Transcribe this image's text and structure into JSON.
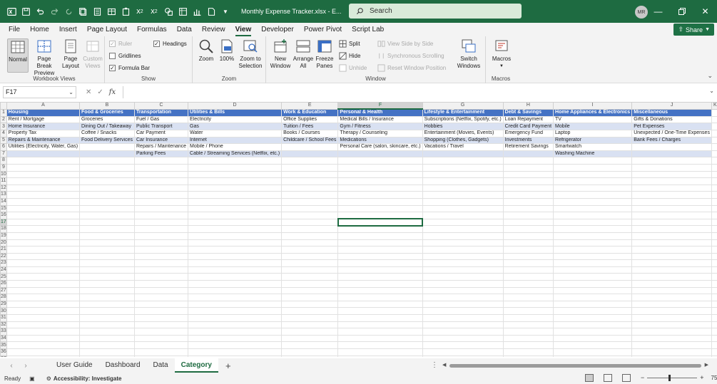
{
  "titlebar": {
    "doc_title": "Monthly Expense Tracker.xlsx  -  E...",
    "search_placeholder": "Search",
    "avatar": "MR"
  },
  "menu": {
    "tabs": [
      "File",
      "Home",
      "Insert",
      "Page Layout",
      "Formulas",
      "Data",
      "Review",
      "View",
      "Developer",
      "Power Pivot",
      "Script Lab"
    ],
    "active_tab": "View",
    "share_label": "Share"
  },
  "ribbon": {
    "workbook_views": {
      "label": "Workbook Views",
      "normal": "Normal",
      "page_break": "Page Break Preview",
      "page_layout": "Page Layout",
      "custom_views": "Custom Views"
    },
    "show": {
      "label": "Show",
      "ruler": "Ruler",
      "gridlines": "Gridlines",
      "formula_bar": "Formula Bar",
      "headings": "Headings"
    },
    "zoom": {
      "label": "Zoom",
      "zoom": "Zoom",
      "hundred": "100%",
      "zoom_selection": "Zoom to Selection"
    },
    "window": {
      "label": "Window",
      "new_window": "New Window",
      "arrange_all": "Arrange All",
      "freeze_panes": "Freeze Panes",
      "split": "Split",
      "hide": "Hide",
      "unhide": "Unhide",
      "view_side": "View Side by Side",
      "sync_scroll": "Synchronous Scrolling",
      "reset_pos": "Reset Window Position",
      "switch_windows": "Switch Windows"
    },
    "macros": {
      "label": "Macros",
      "macros": "Macros"
    }
  },
  "formula_bar": {
    "name_box": "F17",
    "formula": ""
  },
  "grid": {
    "columns": [
      "A",
      "B",
      "C",
      "D",
      "E",
      "F",
      "G",
      "H",
      "I",
      "J",
      "K"
    ],
    "selected_column": "F",
    "selected_row": 17,
    "active_cell": "F17",
    "header_row": [
      "Housing",
      "Food & Groceries",
      "Transportation",
      "Utilities & Bills",
      "Work & Education",
      "Personal & Health",
      "Lifestyle & Entertainment",
      "Debt & Savings",
      "Home Appliances & Electronics",
      "Miscellaneous"
    ],
    "rows": [
      [
        "Rent / Mortgage",
        "Groceries",
        "Fuel / Gas",
        "Electricity",
        "Office Supplies",
        "Medical Bills / Insurance",
        "Subscriptions (Netflix, Spotify, etc.)",
        "Loan Repayment",
        "TV",
        "Gifts & Donations"
      ],
      [
        "Home Insurance",
        "Dining Out / Takeaway",
        "Public Transport",
        "Gas",
        "Tuition / Fees",
        "Gym / Fitness",
        "Hobbies",
        "Credit Card Payment",
        "Mobile",
        "Pet Expenses"
      ],
      [
        "Property Tax",
        "Coffee / Snacks",
        "Car Payment",
        "Water",
        "Books / Courses",
        "Therapy / Counseling",
        "Entertainment (Movies, Events)",
        "Emergency Fund",
        "Laptop",
        "Unexpected / One-Time Expenses"
      ],
      [
        "Repairs & Maintenance",
        "Food Delivery Services",
        "Car Insurance",
        "Internet",
        "Childcare / School Fees",
        "Medications",
        "Shopping (Clothes, Gadgets)",
        "Investments",
        "Refrigerator",
        "Bank Fees / Charges"
      ],
      [
        "Utilities (Electricity, Water, Gas)",
        "",
        "Repairs / Maintenance",
        "Mobile / Phone",
        "",
        "Personal Care (salon, skincare, etc.)",
        "Vacations / Travel",
        "Retirement Savings",
        "Smartwatch",
        ""
      ],
      [
        "",
        "",
        "Parking Fees",
        "Cable / Streaming Services (Netflix, etc.)",
        "",
        "",
        "",
        "",
        "Washing Machine",
        ""
      ]
    ],
    "row_count": 37
  },
  "sheets": {
    "tabs": [
      "User Guide",
      "Dashboard",
      "Data",
      "Category"
    ],
    "active": "Category"
  },
  "status": {
    "ready": "Ready",
    "accessibility": "Accessibility: Investigate",
    "zoom": "75%"
  }
}
